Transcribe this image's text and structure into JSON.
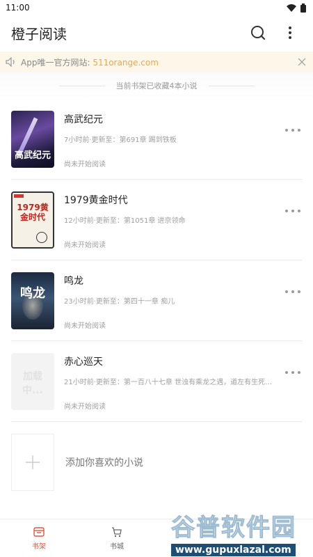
{
  "status_bar": {
    "time": "11:00"
  },
  "header": {
    "title": "橙子阅读"
  },
  "notice": {
    "prefix": "App唯一官方网站: ",
    "url": "511orange.com"
  },
  "shelf": {
    "summary": "当前书架已收藏4本小说"
  },
  "books": [
    {
      "title": "高武纪元",
      "update": "7小时前·更新至：第691章 踢到铁板",
      "status": "尚未开始阅读",
      "cover_text": "高武纪元"
    },
    {
      "title": "1979黄金时代",
      "update": "12小时前·更新至：第1051章 进京领命",
      "status": "尚未开始阅读",
      "cover_text": "1979黄金时代"
    },
    {
      "title": "鸣龙",
      "update": "23小时前·更新至：第四十一章 痴儿",
      "status": "尚未开始阅读",
      "cover_text": "鸣龙"
    },
    {
      "title": "赤心巡天",
      "update": "21小时前·更新至：第一百八十七章 世浊有乘龙之遇，道左有生死之...",
      "status": "尚未开始阅读",
      "cover_text": "加载中..."
    }
  ],
  "add_book": {
    "label": "添加你喜欢的小说"
  },
  "nav": {
    "shelf": "书架",
    "store": "书城"
  },
  "watermark": {
    "title": "谷普软件园",
    "url": "www.gupuxlazal.com"
  },
  "colors": {
    "accent": "#e0573c",
    "notice_bg": "#fdf7ea",
    "link": "#f0a64a"
  }
}
